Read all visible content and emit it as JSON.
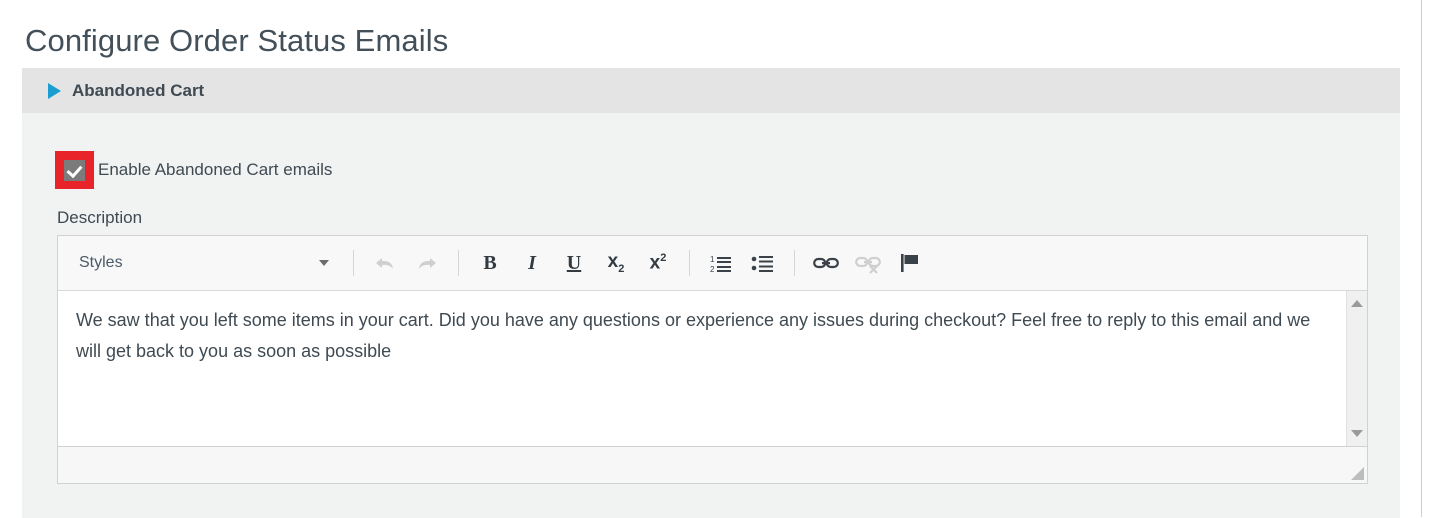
{
  "page": {
    "title": "Configure Order Status Emails"
  },
  "panel": {
    "title": "Abandoned Cart",
    "toggle_icon": "triangle-right-icon",
    "expanded": true,
    "header_bg": "#e4e4e4",
    "body_bg": "#f1f2f2",
    "toggle_color": "#1b9dd1"
  },
  "form": {
    "enable_checkbox": {
      "label": "Enable Abandoned Cart emails",
      "checked": true,
      "highlight_color": "#e8232a",
      "box_color": "#7b7b7b"
    },
    "description": {
      "label": "Description",
      "value": "We saw that you left some items in your cart. Did you have any questions or experience any issues during checkout? Feel free to reply to this email and we will get back to you as soon as possible"
    }
  },
  "editor": {
    "styles_dropdown": {
      "label": "Styles",
      "caret_icon": "chevron-down-icon"
    },
    "buttons": [
      {
        "name": "undo-button",
        "icon": "undo-arrow-icon",
        "label": "Undo",
        "disabled": true
      },
      {
        "name": "redo-button",
        "icon": "redo-arrow-icon",
        "label": "Redo",
        "disabled": true
      },
      {
        "name": "bold-button",
        "icon": "bold-icon",
        "label": "B",
        "disabled": false
      },
      {
        "name": "italic-button",
        "icon": "italic-icon",
        "label": "I",
        "disabled": false
      },
      {
        "name": "underline-button",
        "icon": "underline-icon",
        "label": "U",
        "disabled": false
      },
      {
        "name": "subscript-button",
        "icon": "subscript-icon",
        "label": "x",
        "sublabel": "2",
        "disabled": false
      },
      {
        "name": "superscript-button",
        "icon": "superscript-icon",
        "label": "x",
        "sublabel": "2",
        "disabled": false
      },
      {
        "name": "numbered-list-button",
        "icon": "numbered-list-icon",
        "label": "",
        "disabled": false
      },
      {
        "name": "bulleted-list-button",
        "icon": "bulleted-list-icon",
        "label": "",
        "disabled": false
      },
      {
        "name": "link-button",
        "icon": "link-chain-icon",
        "label": "",
        "disabled": false
      },
      {
        "name": "unlink-button",
        "icon": "unlink-chain-icon",
        "label": "",
        "disabled": true
      },
      {
        "name": "anchor-button",
        "icon": "flag-icon",
        "label": "",
        "disabled": false
      }
    ],
    "scrollbar": {
      "up_icon": "scroll-up-arrow-icon",
      "down_icon": "scroll-down-arrow-icon"
    },
    "resize_grip_icon": "resize-grip-icon"
  }
}
